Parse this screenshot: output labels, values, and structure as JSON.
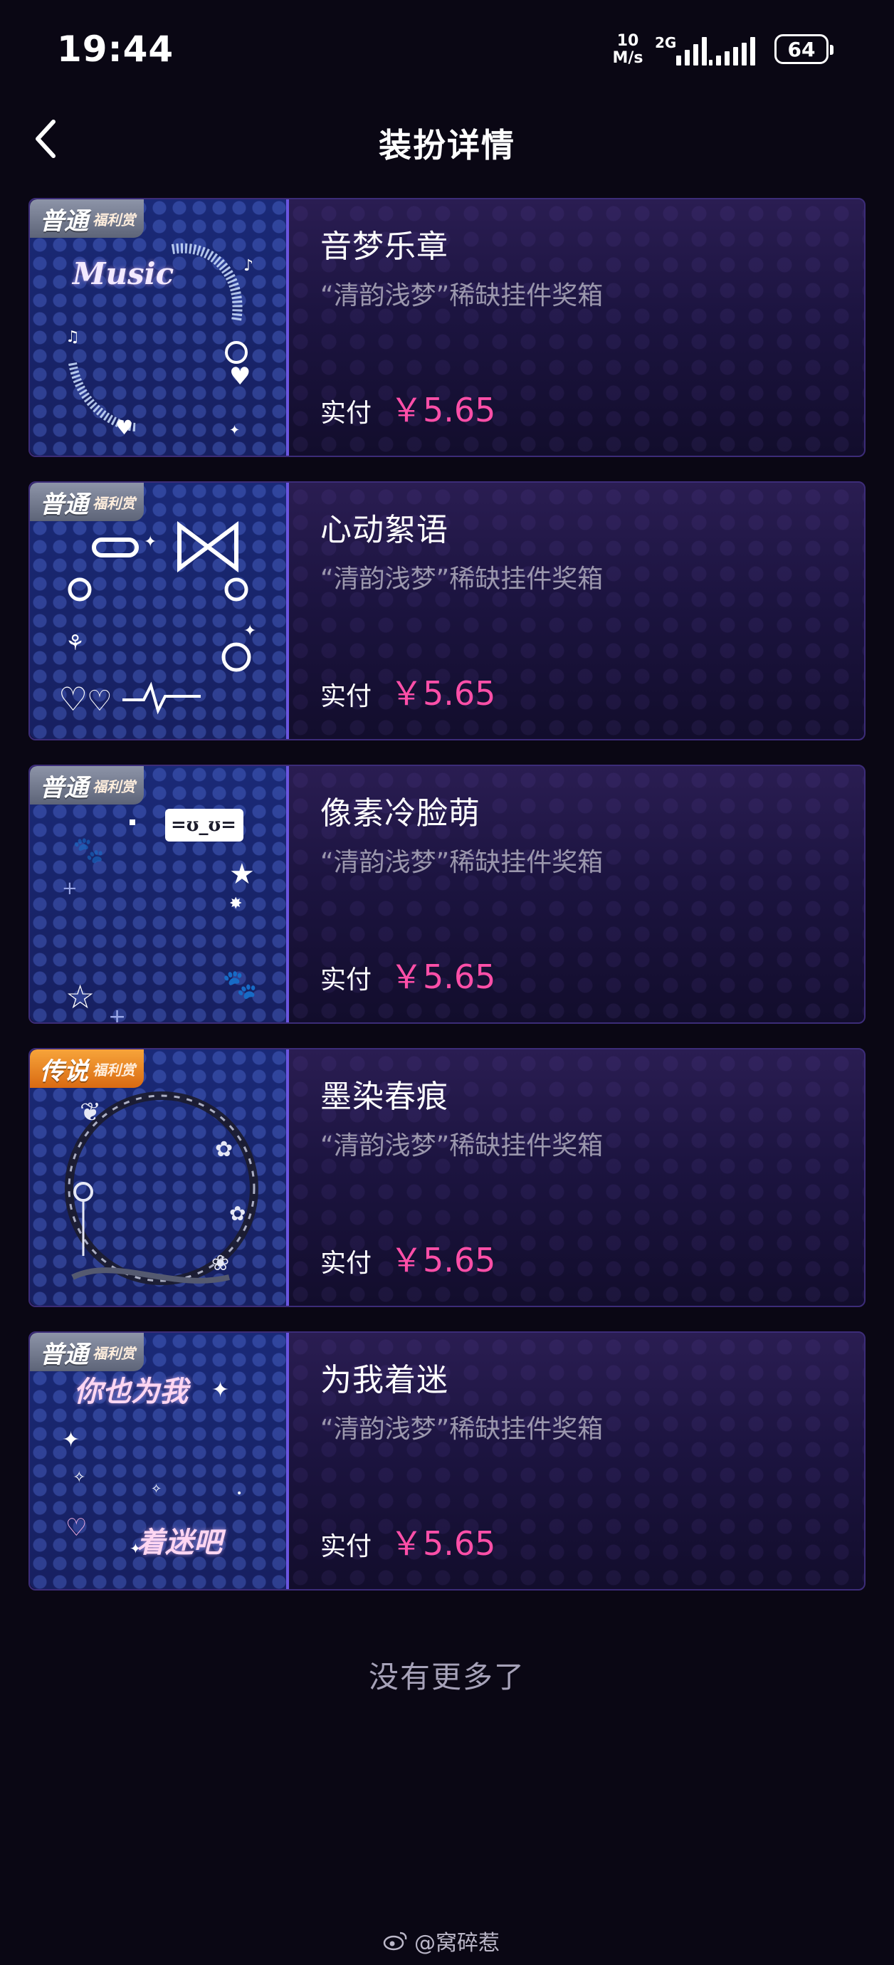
{
  "status_bar": {
    "time": "19:44",
    "net_speed_value": "10",
    "net_speed_unit": "M/s",
    "network_type": "2G",
    "battery": "64"
  },
  "header": {
    "title": "装扮详情",
    "back_icon": "chevron-left-icon"
  },
  "items": [
    {
      "badge_main": "普通",
      "badge_sub": "福利赏",
      "badge_type": "normal",
      "thumb_text": "Music",
      "name": "音梦乐章",
      "desc": "“清韵浅梦”稀缺挂件奖箱",
      "price_label": "实付",
      "price": "￥5.65"
    },
    {
      "badge_main": "普通",
      "badge_sub": "福利赏",
      "badge_type": "normal",
      "thumb_text": "",
      "name": "心动絮语",
      "desc": "“清韵浅梦”稀缺挂件奖箱",
      "price_label": "实付",
      "price": "￥5.65"
    },
    {
      "badge_main": "普通",
      "badge_sub": "福利赏",
      "badge_type": "normal",
      "thumb_text": "=ʊ_ʊ=",
      "name": "像素冷脸萌",
      "desc": "“清韵浅梦”稀缺挂件奖箱",
      "price_label": "实付",
      "price": "￥5.65"
    },
    {
      "badge_main": "传说",
      "badge_sub": "福利赏",
      "badge_type": "legend",
      "thumb_text": "",
      "name": "墨染春痕",
      "desc": "“清韵浅梦”稀缺挂件奖箱",
      "price_label": "实付",
      "price": "￥5.65"
    },
    {
      "badge_main": "普通",
      "badge_sub": "福利赏",
      "badge_type": "normal",
      "thumb_text": "你也为我",
      "thumb_text2": "着迷吧",
      "name": "为我着迷",
      "desc": "“清韵浅梦”稀缺挂件奖箱",
      "price_label": "实付",
      "price": "￥5.65"
    }
  ],
  "end_text": "没有更多了",
  "watermark": "@窝碎惹",
  "colors": {
    "background": "#0a0714",
    "price": "#ff4fa8",
    "card_border": "#3c2c78",
    "thumb_border": "#6a55e0"
  }
}
